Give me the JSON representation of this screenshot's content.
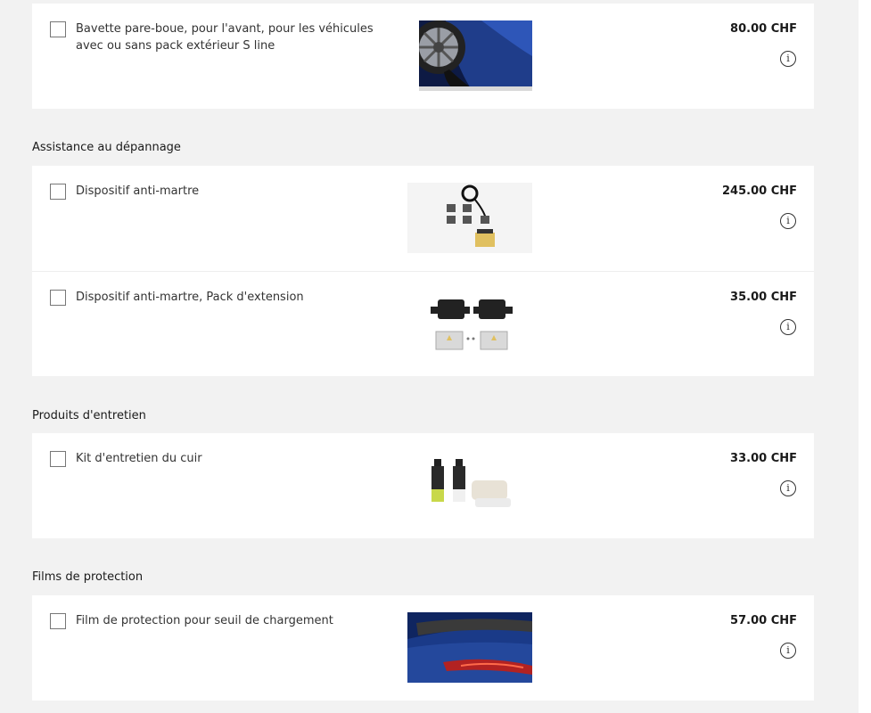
{
  "top_item": {
    "label": "Bavette pare-boue, pour l'avant, pour les véhicules avec ou sans pack extérieur S line",
    "price": "80.00 CHF",
    "image_icon": "wheel-mudflap-photo"
  },
  "sections": [
    {
      "title": "Assistance au dépannage",
      "items": [
        {
          "label": "Dispositif anti-martre",
          "price": "245.00 CHF",
          "image_icon": "anti-marten-kit-photo"
        },
        {
          "label": "Dispositif anti-martre, Pack d'extension",
          "price": "35.00 CHF",
          "image_icon": "anti-marten-extension-photo"
        }
      ]
    },
    {
      "title": "Produits d'entretien",
      "items": [
        {
          "label": "Kit d'entretien du cuir",
          "price": "33.00 CHF",
          "image_icon": "leather-care-kit-photo"
        }
      ]
    },
    {
      "title": "Films de protection",
      "items": [
        {
          "label": "Film de protection pour seuil de chargement",
          "price": "57.00 CHF",
          "image_icon": "loading-sill-film-photo"
        }
      ]
    }
  ],
  "info_glyph": "i",
  "colors": {
    "background": "#f2f2f2",
    "card": "#ffffff",
    "car_blue": "#1f3d8a"
  }
}
